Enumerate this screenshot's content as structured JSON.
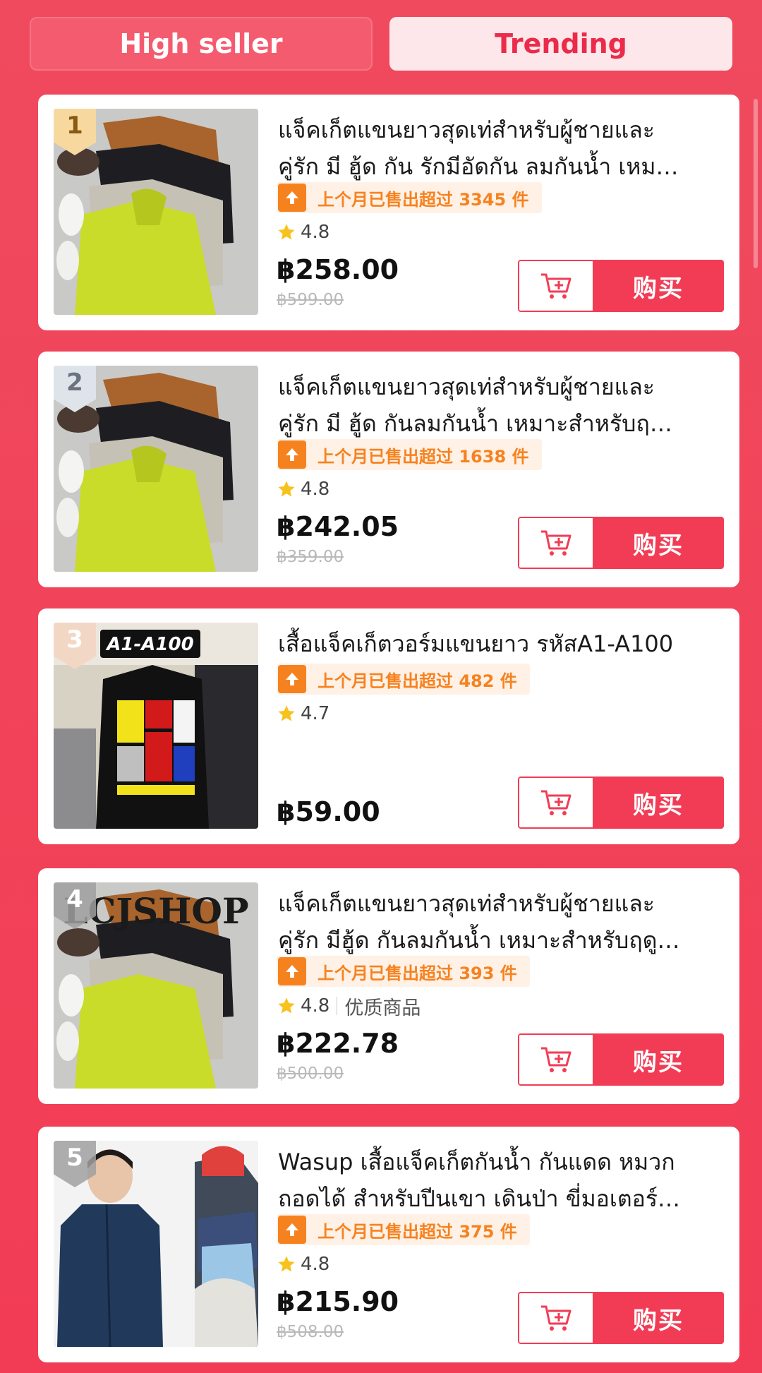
{
  "tabs": {
    "high_seller": "High seller",
    "trending": "Trending"
  },
  "buy_label": "购买",
  "products": [
    {
      "rank": "1",
      "title_line1": "แจ็คเก็ตแขนยาวสุดเท่สำหรับผู้ชายและ",
      "title_line2": "คู่รัก มี ฮู้ด กัน รักมีอัดกัน ลมกันน้ำ เหม…",
      "sold": "上个月已售出超过 3345 件",
      "rating": "4.8",
      "tag": "",
      "price": "฿258.00",
      "old_price": "฿599.00"
    },
    {
      "rank": "2",
      "title_line1": "แจ็คเก็ตแขนยาวสุดเท่สำหรับผู้ชายและ",
      "title_line2": "คู่รัก มี ฮู้ด กันลมกันน้ำ เหมาะสำหรับฤ…",
      "sold": "上个月已售出超过 1638 件",
      "rating": "4.8",
      "tag": "",
      "price": "฿242.05",
      "old_price": "฿359.00"
    },
    {
      "rank": "3",
      "title_line1": "เสื้อแจ็คเก็ตวอร์มแขนยาว รหัสA1-A100",
      "title_line2": "",
      "image_label": "A1-A100",
      "sold": "上个月已售出超过 482 件",
      "rating": "4.7",
      "tag": "",
      "price": "฿59.00",
      "old_price": ""
    },
    {
      "rank": "4",
      "title_line1": "แจ็คเก็ตแขนยาวสุดเท่สำหรับผู้ชายและ",
      "title_line2": "คู่รัก มีฮู้ด กันลมกันน้ำ เหมาะสำหรับฤดู…",
      "image_label": "LCJSHOP",
      "sold": "上个月已售出超过 393 件",
      "rating": "4.8",
      "tag": "优质商品",
      "price": "฿222.78",
      "old_price": "฿500.00"
    },
    {
      "rank": "5",
      "title_line1": "Wasup เสื้อแจ็คเก็ตกันน้ำ กันแดด หมวก",
      "title_line2": "ถอดได้ สำหรับปีนเขา เดินป่า ขี่มอเตอร์…",
      "sold": "上个月已售出超过 375 件",
      "rating": "4.8",
      "tag": "",
      "price": "฿215.90",
      "old_price": "฿508.00"
    }
  ]
}
